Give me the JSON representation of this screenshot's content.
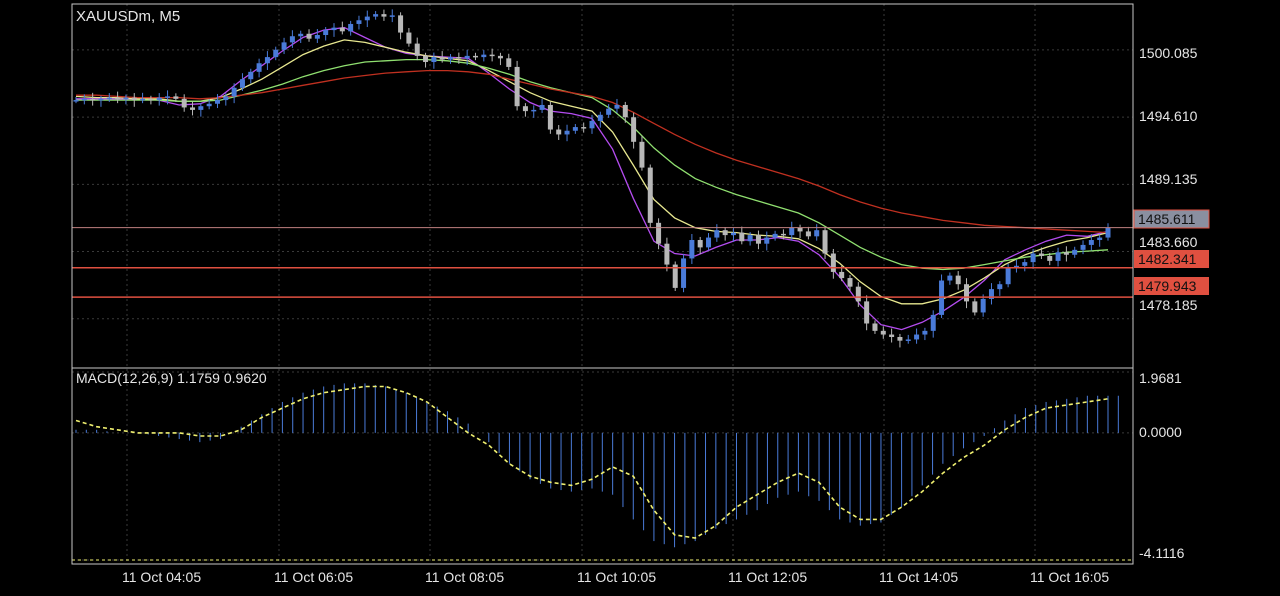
{
  "symbol_label": "XAUUSDm, M5",
  "indicator_label": "MACD(12,26,9) 1.1759 0.9620",
  "colors": {
    "background": "#000000",
    "frame": "#c8c8c8",
    "grid": "#3a3a3a",
    "bull": "#4a7bd9",
    "bear": "#b8b8b8",
    "ma_fast": "#b44cf0",
    "ma_yellow": "#e8e890",
    "ma_green": "#90e070",
    "ma_red": "#c03020",
    "level_line": "#e05040",
    "level_tag": "#e05040",
    "current_price_tag": "#8a8fa0",
    "macd_hist": "#4a7bd9",
    "macd_signal": "#f0f070",
    "text": "#e6e6e6"
  },
  "price_axis": {
    "labels": [
      "1500.085",
      "1494.610",
      "1489.135",
      "1483.660",
      "1478.185"
    ],
    "min": 1474.5,
    "max": 1503.5
  },
  "current_price": "1485.611",
  "levels": [
    "1482.341",
    "1479.943"
  ],
  "time_axis": [
    "11 Oct 04:05",
    "11 Oct 06:05",
    "11 Oct 08:05",
    "11 Oct 10:05",
    "11 Oct 12:05",
    "11 Oct 14:05",
    "11 Oct 16:05"
  ],
  "macd_axis": {
    "labels": [
      "1.9681",
      "0.0000",
      "-4.1116"
    ],
    "min": -4.1116,
    "max": 1.9681
  },
  "chart_data": {
    "type": "candlestick",
    "symbol": "XAUUSDm",
    "timeframe": "M5",
    "close_series": [
      1496.0,
      1496.1,
      1496.0,
      1496.1,
      1496.2,
      1496.1,
      1496.2,
      1496.0,
      1496.1,
      1496.0,
      1496.2,
      1496.3,
      1496.1,
      1495.4,
      1495.2,
      1495.5,
      1495.7,
      1496.0,
      1496.3,
      1497.0,
      1497.7,
      1498.3,
      1499.0,
      1499.5,
      1500.1,
      1500.7,
      1501.2,
      1501.4,
      1501.0,
      1501.3,
      1501.7,
      1501.9,
      1501.6,
      1502.2,
      1502.5,
      1502.8,
      1503.0,
      1502.8,
      1502.9,
      1501.5,
      1500.6,
      1499.6,
      1499.1,
      1499.5,
      1499.3,
      1499.5,
      1499.4,
      1499.6,
      1499.5,
      1499.7,
      1499.6,
      1499.4,
      1498.7,
      1495.5,
      1495.1,
      1495.2,
      1495.6,
      1493.6,
      1493.2,
      1493.5,
      1493.8,
      1493.7,
      1494.3,
      1494.8,
      1495.3,
      1495.6,
      1494.6,
      1492.6,
      1490.5,
      1486.0,
      1484.3,
      1482.6,
      1480.7,
      1483.1,
      1484.6,
      1484.0,
      1484.8,
      1485.4,
      1485.0,
      1485.2,
      1484.5,
      1485.0,
      1484.3,
      1484.8,
      1485.1,
      1485.0,
      1485.6,
      1485.3,
      1484.9,
      1485.4,
      1483.5,
      1482.0,
      1481.5,
      1480.8,
      1479.6,
      1477.8,
      1477.2,
      1476.9,
      1476.7,
      1476.4,
      1476.5,
      1476.9,
      1477.2,
      1478.5,
      1481.3,
      1481.7,
      1481.0,
      1479.6,
      1478.7,
      1479.8,
      1480.6,
      1481.0,
      1482.3,
      1482.5,
      1482.8,
      1483.5,
      1483.3,
      1482.9,
      1483.6,
      1483.4,
      1483.8,
      1484.2,
      1484.6,
      1484.8,
      1485.6
    ],
    "moving_averages": [
      {
        "color_key": "ma_fast",
        "values": [
          1496.1,
          1496.1,
          1496.1,
          1496.1,
          1496.0,
          1495.6,
          1495.7,
          1496.3,
          1497.6,
          1498.8,
          1500.0,
          1501.1,
          1501.7,
          1501.9,
          1501.1,
          1500.3,
          1499.8,
          1499.6,
          1499.5,
          1499.4,
          1498.2,
          1496.9,
          1495.8,
          1495.1,
          1494.9,
          1494.5,
          1492.0,
          1488.0,
          1484.5,
          1483.5,
          1483.3,
          1484.0,
          1484.6,
          1484.6,
          1484.8,
          1484.5,
          1483.4,
          1481.6,
          1479.3,
          1477.7,
          1477.3,
          1477.9,
          1478.8,
          1479.9,
          1481.3,
          1483.0,
          1483.8,
          1484.5,
          1485.0,
          1484.9,
          1485.3
        ]
      },
      {
        "color_key": "ma_yellow",
        "values": [
          1496.3,
          1496.2,
          1496.2,
          1496.1,
          1496.1,
          1495.9,
          1495.9,
          1496.2,
          1496.9,
          1497.7,
          1498.7,
          1499.7,
          1500.4,
          1500.9,
          1500.7,
          1500.3,
          1499.9,
          1499.6,
          1499.4,
          1499.2,
          1498.4,
          1497.5,
          1496.6,
          1495.9,
          1495.5,
          1495.1,
          1493.4,
          1490.7,
          1487.9,
          1486.4,
          1485.6,
          1485.3,
          1485.2,
          1485.0,
          1484.9,
          1484.7,
          1483.9,
          1482.7,
          1481.2,
          1480.0,
          1479.4,
          1479.4,
          1479.8,
          1480.5,
          1481.5,
          1482.6,
          1483.4,
          1484.0,
          1484.5,
          1484.8,
          1485.2
        ]
      },
      {
        "color_key": "ma_green",
        "values": [
          1496.0,
          1496.0,
          1496.0,
          1496.0,
          1496.0,
          1495.9,
          1495.9,
          1496.0,
          1496.4,
          1496.8,
          1497.3,
          1497.9,
          1498.4,
          1498.8,
          1499.1,
          1499.2,
          1499.3,
          1499.3,
          1499.2,
          1499.0,
          1498.6,
          1498.1,
          1497.5,
          1497.0,
          1496.6,
          1496.2,
          1495.2,
          1493.8,
          1492.1,
          1490.7,
          1489.6,
          1488.9,
          1488.3,
          1487.8,
          1487.3,
          1486.8,
          1486.0,
          1485.0,
          1484.0,
          1483.2,
          1482.6,
          1482.3,
          1482.2,
          1482.3,
          1482.6,
          1482.9,
          1483.2,
          1483.4,
          1483.6,
          1483.7,
          1483.8
        ]
      },
      {
        "color_key": "ma_red",
        "values": [
          1496.4,
          1496.4,
          1496.3,
          1496.2,
          1496.2,
          1496.2,
          1496.1,
          1496.2,
          1496.4,
          1496.6,
          1496.9,
          1497.2,
          1497.5,
          1497.8,
          1498.0,
          1498.2,
          1498.3,
          1498.4,
          1498.4,
          1498.3,
          1498.1,
          1497.7,
          1497.3,
          1496.9,
          1496.6,
          1496.3,
          1495.8,
          1495.0,
          1494.1,
          1493.2,
          1492.4,
          1491.7,
          1491.1,
          1490.6,
          1490.1,
          1489.6,
          1489.0,
          1488.3,
          1487.7,
          1487.2,
          1486.8,
          1486.5,
          1486.2,
          1486.0,
          1485.8,
          1485.7,
          1485.6,
          1485.5,
          1485.4,
          1485.3,
          1485.2
        ]
      }
    ],
    "macd": {
      "params": "12,26,9",
      "main": 1.1759,
      "signal": 0.962,
      "histogram": [
        0.1,
        0.1,
        0.0,
        0.0,
        -0.1,
        -0.2,
        -0.3,
        -0.2,
        0.2,
        0.6,
        1.0,
        1.3,
        1.5,
        1.6,
        1.6,
        1.5,
        1.3,
        1.0,
        0.7,
        0.3,
        -0.3,
        -1.0,
        -1.5,
        -1.8,
        -1.9,
        -1.8,
        -2.0,
        -2.8,
        -3.5,
        -3.7,
        -3.5,
        -3.1,
        -2.8,
        -2.5,
        -2.1,
        -1.9,
        -2.2,
        -2.8,
        -3.0,
        -2.9,
        -2.4,
        -1.7,
        -1.0,
        -0.5,
        -0.1,
        0.4,
        0.8,
        1.0,
        1.1,
        1.2,
        1.2
      ],
      "signal_series": [
        0.4,
        0.2,
        0.1,
        0.0,
        0.0,
        0.0,
        -0.1,
        -0.1,
        0.1,
        0.5,
        0.8,
        1.1,
        1.3,
        1.4,
        1.5,
        1.5,
        1.3,
        1.0,
        0.5,
        0.0,
        -0.4,
        -1.0,
        -1.4,
        -1.6,
        -1.7,
        -1.5,
        -1.1,
        -1.4,
        -2.5,
        -3.3,
        -3.4,
        -3.0,
        -2.4,
        -2.0,
        -1.6,
        -1.3,
        -1.6,
        -2.4,
        -2.8,
        -2.8,
        -2.4,
        -1.9,
        -1.3,
        -0.8,
        -0.4,
        0.1,
        0.5,
        0.8,
        0.9,
        1.0,
        1.1
      ]
    }
  }
}
